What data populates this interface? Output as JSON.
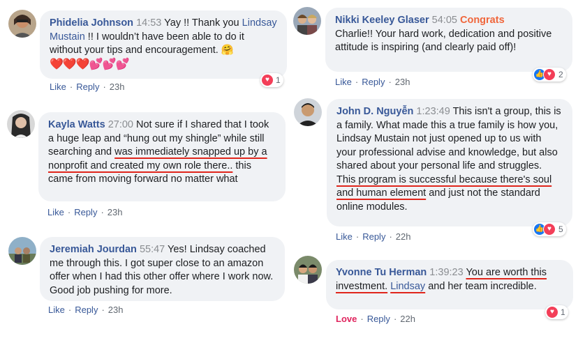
{
  "comments": [
    {
      "name": "Phidelia Johnson",
      "time": "14:53",
      "pre": "Yay !! Thank you ",
      "mention": "Lindsay Mustain",
      "post": " !! I wouldn’t have been able to do it without your tips and encouragement. 🤗",
      "emoji_row": "❤️❤️❤️💕💕💕",
      "reactions": "1",
      "actions": {
        "like": "Like",
        "reply": "Reply",
        "ago": "23h"
      }
    },
    {
      "name": "Kayla Watts",
      "time": "27:00",
      "t1": "Not sure if I shared that I took a huge leap and “hung out my shingle” while still searching and ",
      "u1": "was immediately snapped up by a nonprofit and created my own role there..",
      "t2": " this came from moving forward no matter what",
      "actions": {
        "like": "Like",
        "reply": "Reply",
        "ago": "23h"
      }
    },
    {
      "name": "Jeremiah Jourdan",
      "time": "55:47",
      "text": "Yes! Lindsay coached me through this. I got super close to an amazon offer when I had this other offer where I work now. Good job pushing for more.",
      "actions": {
        "like": "Like",
        "reply": "Reply",
        "ago": "23h"
      }
    },
    {
      "name": "Nikki Keeley Glaser",
      "time": "54:05",
      "congrats": "Congrats",
      "text": "Charlie!! Your hard work, dedication and positive attitude is inspiring (and clearly paid off)!",
      "reactions": "2",
      "actions": {
        "like": "Like",
        "reply": "Reply",
        "ago": "23h"
      }
    },
    {
      "name": "John D. Nguyễn",
      "time": "1:23:49",
      "t1": "This isn't a group, this is a family. What made this a true family is how you, Lindsay Mustain not just opened up to us with your professional advise and knowledge, but also shared about your personal life and struggles. ",
      "u1": "This program is successful because there's soul and human element",
      "t2": " and just not the standard online modules.",
      "reactions": "5",
      "actions": {
        "like": "Like",
        "reply": "Reply",
        "ago": "22h"
      }
    },
    {
      "name": "Yvonne Tu Herman",
      "time": "1:39:23",
      "u1": "You are worth this investment.",
      "mention": "Lindsay",
      "t2": " and her team incredible.",
      "reactions": "1",
      "actions": {
        "like": "Love",
        "reply": "Reply",
        "ago": "22h"
      }
    }
  ]
}
